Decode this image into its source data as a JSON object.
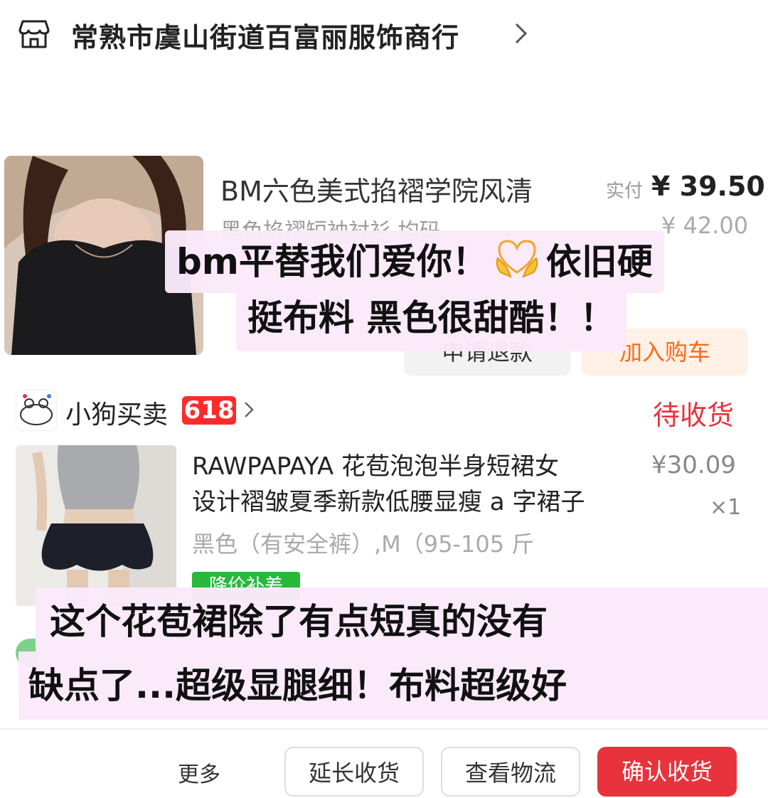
{
  "store1": {
    "name": "常熟市虞山街道百富丽服饰商行",
    "icon": "store-icon"
  },
  "product1": {
    "title": "BM六色美式掐褶学院风清",
    "spec": "黑色掐褶短袖衬衫 均码",
    "paid_label": "实付",
    "paid_price": "¥ 39.50",
    "original_price": "¥ 42.00",
    "refund_button": "申请退款",
    "cart_button": "加入购车"
  },
  "caption1": {
    "line1_a": "bm平替我们爱你！",
    "line1_b": "依旧硬",
    "line2": "挺布料 黑色很甜酷！！"
  },
  "store2": {
    "name": "小狗买卖",
    "badge": "618",
    "status": "待收货"
  },
  "product2": {
    "title_line1": "RAWPAPAYA 花苞泡泡半身短裙女",
    "title_line2": "设计褶皱夏季新款低腰显瘦 a 字裙子",
    "spec": "黑色（有安全裤）,M（95-105 斤",
    "price": "¥30.09",
    "quantity": "×1",
    "tag": "降价补差"
  },
  "caption2": {
    "line1": "这个花苞裙除了有点短真的没有",
    "line2": "缺点了...超级显腿细！布料超级好"
  },
  "bottom_bar": {
    "more": "更多",
    "btn1": "延长收货",
    "btn2": "查看物流",
    "btn3": "确认收货"
  },
  "colors": {
    "accent_red": "#e8323c",
    "badge_red": "#ff2b2b",
    "cart_orange": "#ff6a1a",
    "caption_bg": "#fae9fa",
    "tag_green": "#27b83c"
  }
}
